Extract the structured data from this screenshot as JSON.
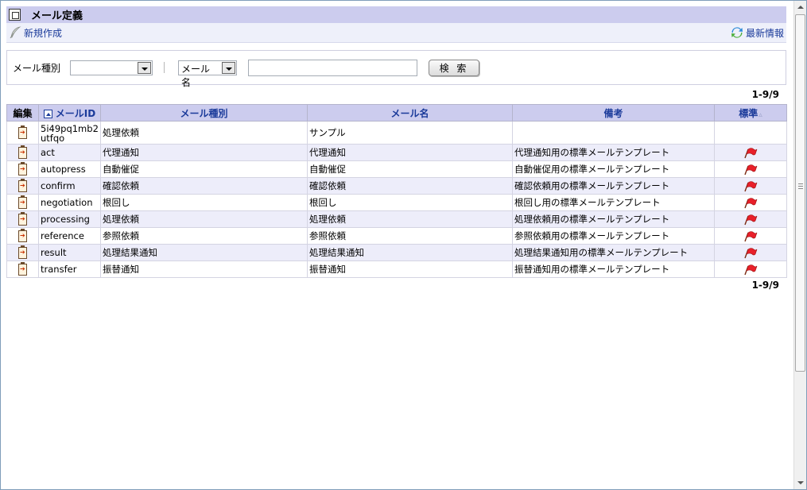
{
  "title": "メール定義",
  "commands": {
    "new_label": "新規作成",
    "refresh_label": "最新情報"
  },
  "search": {
    "type_label": "メール種別",
    "type_value": "",
    "field_select_value": "メール名",
    "keyword_value": "",
    "search_button_label": "検 索"
  },
  "pager": {
    "top": "1-9/9",
    "bottom": "1-9/9"
  },
  "table": {
    "headers": {
      "edit": "編集",
      "mail_id": "メールID",
      "mail_type": "メール種別",
      "mail_name": "メール名",
      "remarks": "備考",
      "standard": "標準"
    },
    "rows": [
      {
        "mail_id": "5i49pq1mb2utfqo",
        "mail_type": "処理依頼",
        "mail_name": "サンプル",
        "remarks": "",
        "standard": false
      },
      {
        "mail_id": "act",
        "mail_type": "代理通知",
        "mail_name": "代理通知",
        "remarks": "代理通知用の標準メールテンプレート",
        "standard": true
      },
      {
        "mail_id": "autopress",
        "mail_type": "自動催促",
        "mail_name": "自動催促",
        "remarks": "自動催促用の標準メールテンプレート",
        "standard": true
      },
      {
        "mail_id": "confirm",
        "mail_type": "確認依頼",
        "mail_name": "確認依頼",
        "remarks": "確認依頼用の標準メールテンプレート",
        "standard": true
      },
      {
        "mail_id": "negotiation",
        "mail_type": "根回し",
        "mail_name": "根回し",
        "remarks": "根回し用の標準メールテンプレート",
        "standard": true
      },
      {
        "mail_id": "processing",
        "mail_type": "処理依頼",
        "mail_name": "処理依頼",
        "remarks": "処理依頼用の標準メールテンプレート",
        "standard": true
      },
      {
        "mail_id": "reference",
        "mail_type": "参照依頼",
        "mail_name": "参照依頼",
        "remarks": "参照依頼用の標準メールテンプレート",
        "standard": true
      },
      {
        "mail_id": "result",
        "mail_type": "処理結果通知",
        "mail_name": "処理結果通知",
        "remarks": "処理結果通知用の標準メールテンプレート",
        "standard": true
      },
      {
        "mail_id": "transfer",
        "mail_type": "振替通知",
        "mail_name": "振替通知",
        "remarks": "振替通知用の標準メールテンプレート",
        "standard": true
      }
    ]
  },
  "colors": {
    "header_bg": "#ccccee",
    "link": "#1a3a9a",
    "alt_row": "#ededfa",
    "flag": "#e8202a"
  },
  "icons": {
    "title": "window-icon",
    "new": "feather-pen-icon",
    "refresh": "refresh-icon",
    "edit": "edit-document-icon",
    "standard": "red-flag-icon"
  }
}
